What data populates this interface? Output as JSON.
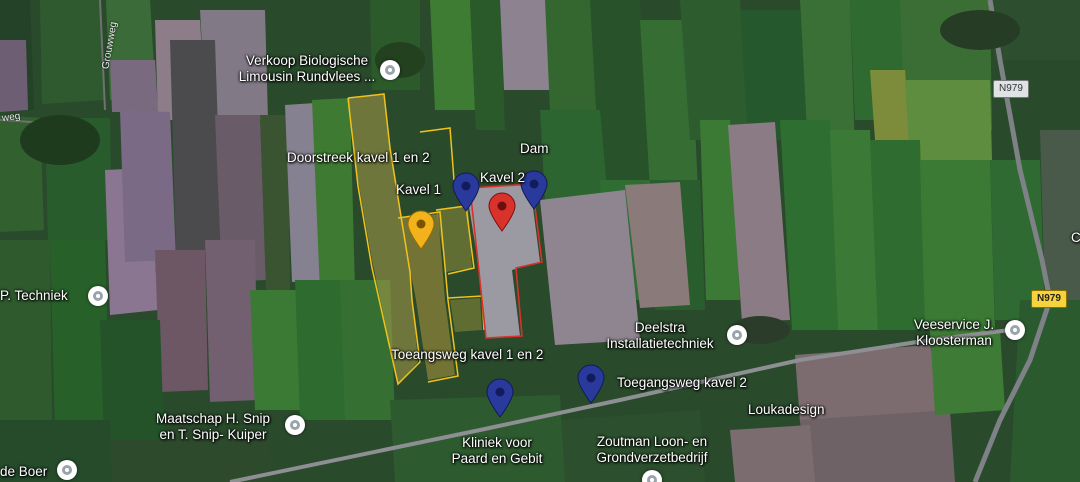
{
  "map": {
    "type": "satellite",
    "parcels": [
      {
        "name": "Doorstreek kavel 1 en 2",
        "outline_color": "#f2c21b"
      },
      {
        "name": "Kavel 2",
        "outline_color": "#d8322b"
      }
    ],
    "markers": [
      {
        "label": "Kavel 1",
        "color": "#f2b21b",
        "icon": "yellow-pin-icon"
      },
      {
        "label": "Kavel 2",
        "color": "#d8322b",
        "icon": "red-pin-icon"
      },
      {
        "label": "Doorstreek kavel 1 en 2",
        "color": "#2a3a9c",
        "icon": "blue-pin-icon"
      },
      {
        "label": "Dam",
        "color": "#2a3a9c",
        "icon": "blue-pin-icon"
      },
      {
        "label": "Toegangsweg kavel 1 en 2",
        "color": "#2a3a9c",
        "icon": "blue-pin-icon"
      },
      {
        "label": "Toegangsweg kavel 2",
        "color": "#2a3a9c",
        "icon": "blue-pin-icon"
      }
    ],
    "labels": {
      "verkoop": "Verkoop Biologische Limousin Rundvlees ...",
      "doorstreek": "Doorstreek kavel 1 en 2",
      "dam": "Dam",
      "kavel1": "Kavel 1",
      "kavel2": "Kavel 2",
      "techniek": "P. Techniek",
      "deelstra": "Deelstra Installatietechniek",
      "veeservice": "Veeservice J. Kloosterman",
      "toegang12": "Toeangsweg kavel 1 en 2",
      "toegang2": "Toegangsweg kavel 2",
      "loukadesign": "Loukadesign",
      "maatschap": "Maatschap H. Snip en T. Snip- Kuiper",
      "kliniek": "Kliniek voor Paard en Gebit",
      "zoutman": "Zoutman Loon- en Grondverzetbedrijf",
      "deboer": "de Boer",
      "edge_c": "C"
    },
    "road_shields": [
      "N979",
      "N979"
    ],
    "street_names": [
      "Grouwweg",
      "weg"
    ],
    "poi_icon": "place-icon"
  }
}
